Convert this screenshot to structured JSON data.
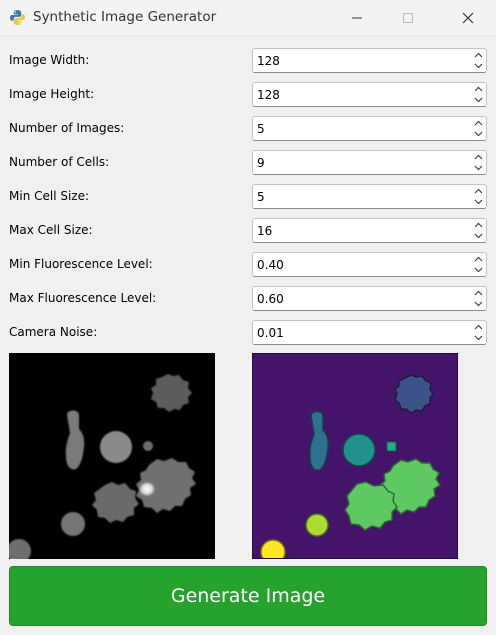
{
  "window": {
    "title": "Synthetic Image Generator",
    "icon": "python-icon",
    "controls": [
      "minimize-icon",
      "maximize-icon",
      "close-icon"
    ]
  },
  "params": [
    {
      "label": "Image Width:",
      "value": "128"
    },
    {
      "label": "Image Height:",
      "value": "128"
    },
    {
      "label": "Number of Images:",
      "value": "5"
    },
    {
      "label": "Number of Cells:",
      "value": "9"
    },
    {
      "label": "Min Cell Size:",
      "value": "5"
    },
    {
      "label": "Max Cell Size:",
      "value": "16"
    },
    {
      "label": "Min Fluorescence Level:",
      "value": "0.40"
    },
    {
      "label": "Max Fluorescence Level:",
      "value": "0.60"
    },
    {
      "label": "Camera Noise:",
      "value": "0.01"
    }
  ],
  "images": {
    "synthetic_background": "#000000",
    "mask_background": "#44146b"
  },
  "generate_button": {
    "label": "Generate Image",
    "color": "#25a32d"
  }
}
